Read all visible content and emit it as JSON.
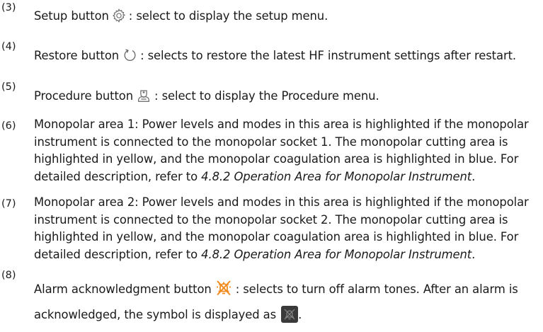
{
  "items": [
    {
      "num": "(3)",
      "lines": [
        {
          "a": "Setup button",
          "icon": "gear-icon",
          "b": ": select to display the setup menu."
        }
      ]
    },
    {
      "num": "(4)",
      "lines": [
        {
          "a": "Restore button",
          "icon": "restore-icon",
          "b": ": selects to restore the latest HF instrument settings after restart."
        }
      ]
    },
    {
      "num": "(5)",
      "lines": [
        {
          "a": "Procedure button",
          "icon": "nurse-icon",
          "b": ": select to display the Procedure menu."
        }
      ]
    },
    {
      "num": "(6)",
      "lines": [
        "Monopolar area 1: Power levels and modes in this area is highlighted if the monopolar",
        "instrument is connected to the monopolar socket 1. The monopolar cutting area is",
        "highlighted in yellow, and the monopolar coagulation area is highlighted in blue. For",
        {
          "a": "detailed description, refer to ",
          "ref": "4.8.2 Operation Area for Monopolar Instrument",
          "b": "."
        }
      ]
    },
    {
      "num": "(7)",
      "lines": [
        "Monopolar area 2: Power levels and modes in this area is highlighted if the monopolar",
        "instrument is connected to the monopolar socket 2. The monopolar cutting area is",
        "highlighted in yellow, and the monopolar coagulation area is highlighted in blue. For",
        {
          "a": "detailed description, refer to ",
          "ref": "4.8.2 Operation Area for Monopolar Instrument",
          "b": "."
        }
      ]
    },
    {
      "num": "(8)",
      "lines": [
        {
          "a": "Alarm acknowledgment button",
          "icon": "alarm-icon",
          "b": ": selects to turn off alarm tones. After an alarm is"
        },
        {
          "a": "acknowledged, the symbol is displayed as",
          "icon": "alarm-muted-icon",
          "b": "."
        }
      ]
    }
  ],
  "colors": {
    "text": "#1a1a1a",
    "icon_gray": "#666666",
    "alarm_orange": "#f08a1c",
    "muted_bg": "#3a3a3a"
  }
}
